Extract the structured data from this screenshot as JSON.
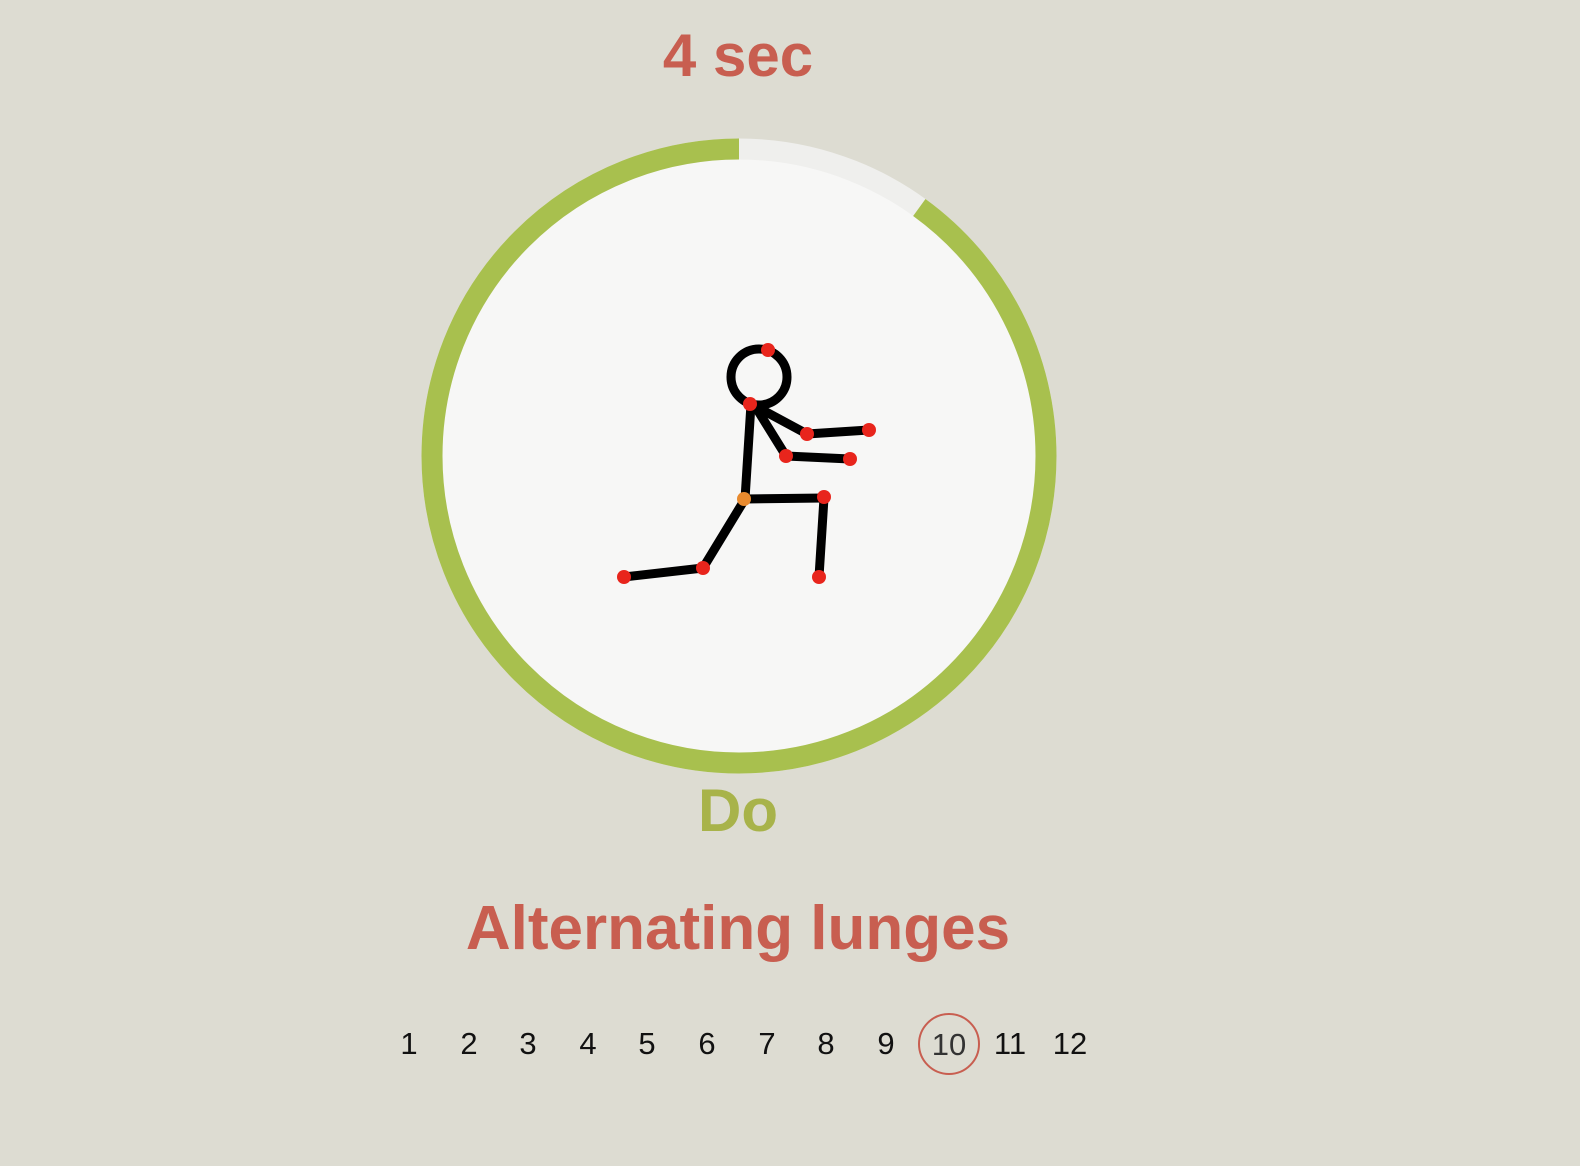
{
  "timer": {
    "remaining_text": "4 sec",
    "progress_fraction": 0.9
  },
  "phase": {
    "label": "Do"
  },
  "exercise": {
    "title": "Alternating lunges",
    "figure_icon": "stick-figure-lunge-icon"
  },
  "pager": {
    "pages": [
      "1",
      "2",
      "3",
      "4",
      "5",
      "6",
      "7",
      "8",
      "9",
      "10",
      "11",
      "12"
    ],
    "current": "10"
  },
  "colors": {
    "background": "#dddcd2",
    "accent_red": "#c85e50",
    "progress_green": "#a8c04e",
    "track": "#efefed",
    "disc": "#f7f7f6",
    "joint_red": "#e8251c",
    "joint_orange": "#e88a2e"
  }
}
